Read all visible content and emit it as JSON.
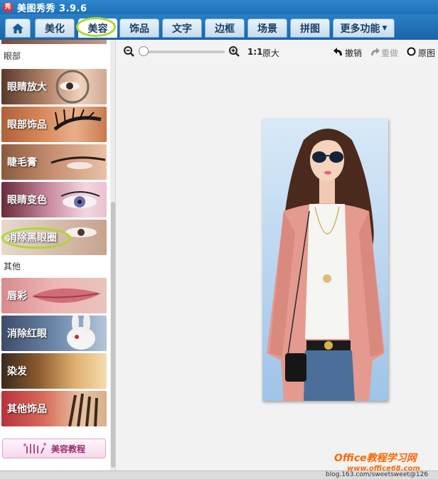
{
  "app": {
    "icon_glyph": "秀",
    "title": "美图秀秀 3.9.6"
  },
  "tabs": [
    {
      "label": "美化"
    },
    {
      "label": "美容",
      "active": true
    },
    {
      "label": "饰品"
    },
    {
      "label": "文字"
    },
    {
      "label": "边框"
    },
    {
      "label": "场景"
    },
    {
      "label": "拼图"
    },
    {
      "label": "更多功能",
      "dropdown": true
    }
  ],
  "panel": {
    "section_eyes": "眼部",
    "section_other": "其他",
    "items": [
      {
        "label": "眼睛放大"
      },
      {
        "label": "眼部饰品"
      },
      {
        "label": "睫毛膏"
      },
      {
        "label": "眼睛变色"
      },
      {
        "label": "消除黑眼圈",
        "highlighted": true
      },
      {
        "label": "唇彩"
      },
      {
        "label": "消除红眼"
      },
      {
        "label": "染发"
      },
      {
        "label": "其他饰品"
      }
    ],
    "tutorial_label": "美容教程"
  },
  "toolbar": {
    "zoom_ratio": "1:1",
    "original_size": "原大",
    "undo": "撤销",
    "redo": "重做",
    "original_image": "原图"
  },
  "status": {
    "text": "blog.163.com/sweetsweet@126"
  },
  "watermark": {
    "line1": "Office教程学习网",
    "line2": "www.office68.com"
  },
  "colors": {
    "tabbar": "#1f6fb8",
    "highlight_ring": "#a8d92b",
    "cardigan": "#e59a8f"
  }
}
